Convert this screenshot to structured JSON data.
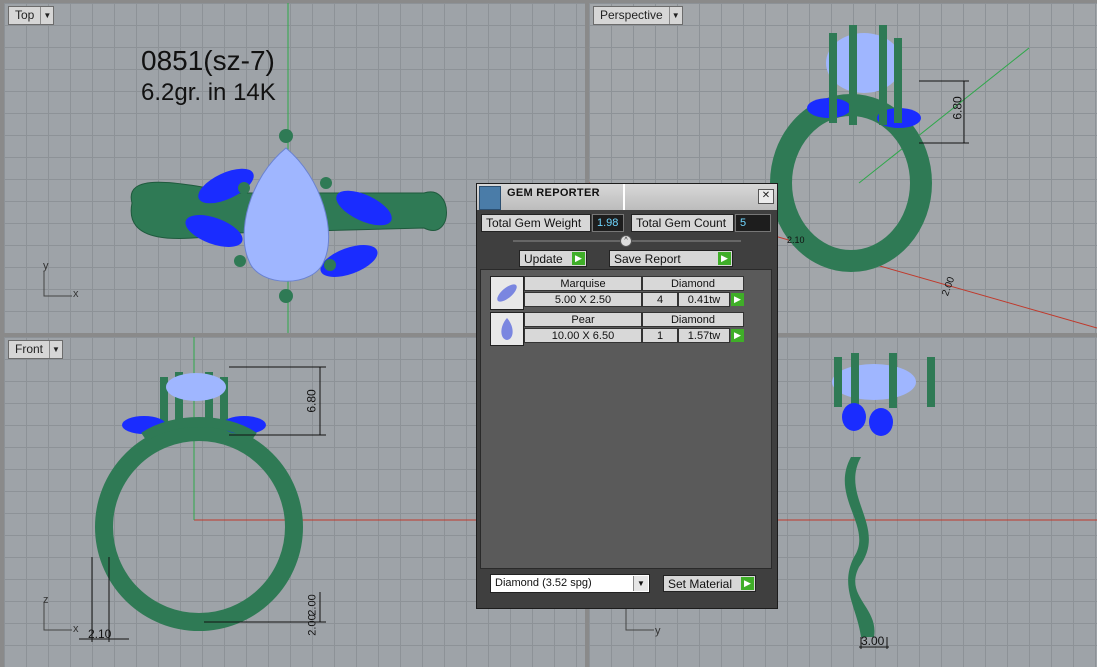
{
  "viewports": {
    "top": {
      "label": "Top",
      "axis_y": "y",
      "axis_x": "x",
      "caption_line1": "0851(sz-7)",
      "caption_line2": "6.2gr.  in 14K"
    },
    "perspective": {
      "label": "Perspective",
      "dim_height": "6.80",
      "dim_band": "2.00",
      "dim_side": "2.10"
    },
    "front": {
      "label": "Front",
      "axis_z": "z",
      "axis_x": "x",
      "dim_height": "6.80",
      "dim_width": "2.10",
      "dim_band1": "2.00",
      "dim_band2": "2.00"
    },
    "right": {
      "axis_z": "z",
      "axis_y": "y",
      "dim_width": "3.00"
    }
  },
  "dialog": {
    "title": "GEM REPORTER",
    "close_glyph": "✕",
    "weight_label": "Total Gem Weight",
    "weight_value": "1.98",
    "count_label": "Total Gem Count",
    "count_value": "5",
    "slider_glyph": "^",
    "update_label": "Update",
    "save_label": "Save Report",
    "arrow_glyph": "▶",
    "gems": [
      {
        "shape": "Marquise",
        "material": "Diamond",
        "size": "5.00 X 2.50",
        "count": "4",
        "tw": "0.41tw"
      },
      {
        "shape": "Pear",
        "material": "Diamond",
        "size": "10.00 X 6.50",
        "count": "1",
        "tw": "1.57tw"
      }
    ],
    "material_select": "Diamond    (3.52 spg)",
    "set_material_label": "Set Material"
  },
  "colors": {
    "metal": "#2e7a55",
    "metal_light": "#3e9a6e",
    "gem_blue": "#1a2cff",
    "gem_pale": "#9fb6ff",
    "axis_red": "#c0392b",
    "axis_green": "#2ea84a"
  }
}
